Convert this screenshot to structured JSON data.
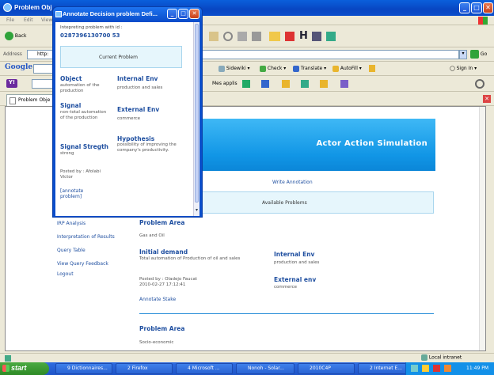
{
  "main_window": {
    "title": "Problem Obj"
  },
  "menu": [
    "File",
    "Edit",
    "View"
  ],
  "nav": {
    "back_label": "Back",
    "address_label": "Address",
    "address_value": "http:",
    "go_label": "Go"
  },
  "google_bar": {
    "logo": "Google",
    "sidewiki": "Sidewiki",
    "check": "Check",
    "translate": "Translate",
    "autofill": "AutoFill",
    "sign_in": "Sign In"
  },
  "links_bar": {
    "mes_applis": "Mes applis"
  },
  "tab": {
    "label": "Problem Obje"
  },
  "banner": {
    "title": "Actor Action Simulation"
  },
  "page": {
    "write_annotation": "Write Annotation",
    "available_problems": "Available Problems",
    "sidebar_links": [
      "IRP Analysis",
      "Interpretation of Results",
      "Query Table",
      "View Query Feedback",
      "Logout"
    ],
    "problem_area_label": "Problem Area",
    "problem_area_value": "Gas and Oil",
    "initial_demand_label": "Initial demand",
    "initial_demand_value": "Total automation of Production of oil and sales",
    "posted_by": "Posted by : Oladejo Faucat",
    "posted_date": "2010-02-27 17:12:41",
    "annotate_stake": "Annotate Stake",
    "internal_env_label": "Internal Env",
    "internal_env_value": "production and sales",
    "external_env_label": "External env",
    "external_env_value": "commerce",
    "problem_area2_label": "Problem Area",
    "problem_area2_value": "Socio-economic"
  },
  "popup": {
    "title": "Annotate Decision problem Defi...",
    "interpreting_label": "Intepreting problem with id :",
    "problem_id": "0287396130700 53",
    "current_problem": "Current Problem",
    "object_label": "Object",
    "object_value": "automation of the production",
    "internal_env_label": "Internal Env",
    "internal_env_value": "production and sales",
    "signal_label": "Signal",
    "signal_value": "non-total automation of the production",
    "external_env_label": "External Env",
    "external_env_value": "commerce",
    "signal_strength_label": "Signal Stregth",
    "signal_strength_value": "strong",
    "hypothesis_label": "Hypothesis",
    "hypothesis_value": "possibility of improving the company's productivity.",
    "posted_by": "Posted by : Afolabi Victor",
    "annotate_link": "[annotate problem]"
  },
  "status": {
    "zone": "Local intranet"
  },
  "taskbar": {
    "start": "start",
    "tasks": [
      "9 Dictionnaires...",
      "2 Firefox",
      "4 Microsoft ...",
      "Nonoh - Solar...",
      "2010C4P",
      "2 Internet E..."
    ],
    "clock": "11:49 PM"
  },
  "colors": {
    "accent": "#1F4FA0",
    "banner": "#1196E6",
    "xp_blue": "#0A4DCB"
  }
}
